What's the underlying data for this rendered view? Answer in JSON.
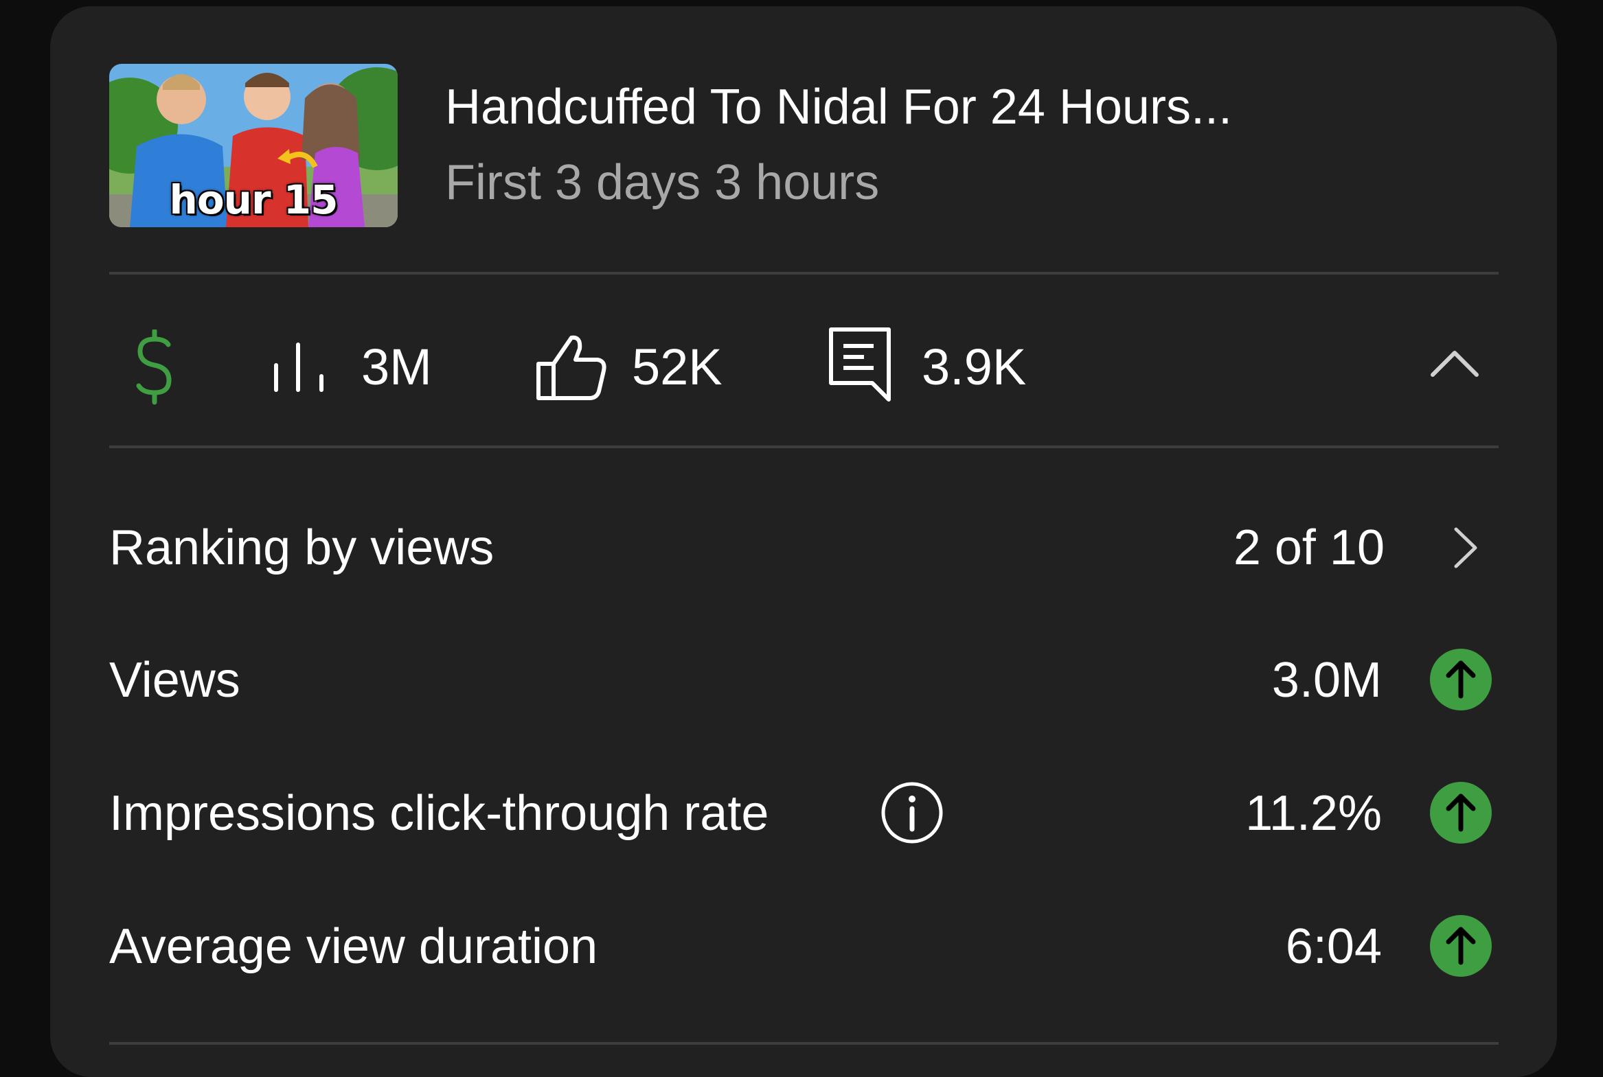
{
  "video": {
    "thumbnail_caption": "hour 15",
    "title": "Handcuffed To Nidal For 24 Hours...",
    "subtitle": "First 3 days 3 hours"
  },
  "stats": {
    "views": "3M",
    "likes": "52K",
    "comments": "3.9K"
  },
  "metrics": [
    {
      "label": "Ranking by views",
      "value": "2 of 10",
      "trailing_icon": "chevron-right-icon"
    },
    {
      "label": "Views",
      "value": "3.0M",
      "trailing_icon": "arrow-up-icon"
    },
    {
      "label": "Impressions click-through rate",
      "value": "11.2%",
      "trailing_icon": "arrow-up-icon"
    },
    {
      "label": "Average view duration",
      "value": "6:04",
      "trailing_icon": "arrow-up-icon"
    }
  ],
  "icons": {
    "revenue": "dollar-icon",
    "views": "bar-chart-icon",
    "likes": "thumbs-up-icon",
    "comments": "comment-icon",
    "collapse": "chevron-up-icon",
    "info": "info-icon"
  },
  "colors": {
    "background": "#0d0d0d",
    "card": "#212121",
    "divider": "#3d3d3d",
    "accent_green": "#3f9e41",
    "muted_text": "#a8a8a8"
  }
}
